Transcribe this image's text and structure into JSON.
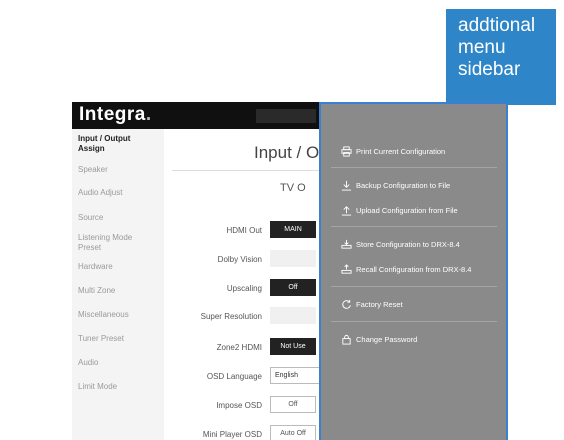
{
  "annotation": {
    "callout_lines": [
      "addtional",
      "menu",
      "sidebar"
    ]
  },
  "app": {
    "logo": "Integra",
    "logo_suffix": "."
  },
  "sidebar": {
    "items": [
      {
        "label": "Input / Output\nAssign",
        "active": true
      },
      {
        "label": "Speaker",
        "active": false
      },
      {
        "label": "Audio Adjust",
        "active": false
      },
      {
        "label": "Source",
        "active": false
      },
      {
        "label": "Listening Mode\nPreset",
        "active": false
      },
      {
        "label": "Hardware",
        "active": false
      },
      {
        "label": "Multi Zone",
        "active": false
      },
      {
        "label": "Miscellaneous",
        "active": false
      },
      {
        "label": "Tuner Preset",
        "active": false
      },
      {
        "label": "Audio",
        "active": false
      },
      {
        "label": "Limit Mode",
        "active": false
      }
    ]
  },
  "main": {
    "title": "Input / O",
    "subtitle": "TV O",
    "rows": [
      {
        "label": "HDMI Out",
        "value": "MAIN",
        "style": "dark"
      },
      {
        "label": "Dolby Vision",
        "value": "",
        "style": "placeholder"
      },
      {
        "label": "Upscaling",
        "value": "Off",
        "style": "dark"
      },
      {
        "label": "Super Resolution",
        "value": "",
        "style": "placeholder"
      },
      {
        "label": "Zone2 HDMI",
        "value": "Not Use",
        "style": "dark"
      },
      {
        "label": "OSD Language",
        "value": "English",
        "style": "select"
      },
      {
        "label": "Impose OSD",
        "value": "Off",
        "style": "light"
      },
      {
        "label": "Mini Player OSD",
        "value": "Auto Off",
        "style": "light"
      }
    ]
  },
  "overlay_menu": {
    "items": [
      {
        "label": "Print Current Configuration",
        "icon": "printer-icon"
      },
      {
        "label": "Backup Configuration to File",
        "icon": "download-icon"
      },
      {
        "label": "Upload Configuration from File",
        "icon": "upload-icon"
      },
      {
        "label": "Store Configuration to DRX-8.4",
        "icon": "store-to-device-icon"
      },
      {
        "label": "Recall Configuration from DRX-8.4",
        "icon": "recall-from-device-icon"
      },
      {
        "label": "Factory Reset",
        "icon": "reset-icon"
      },
      {
        "label": "Change Password",
        "icon": "lock-icon"
      }
    ]
  },
  "colors": {
    "callout": "#2e86c9",
    "overlay_bg": "#8a8a8a",
    "overlay_border": "#3a7fd0",
    "topbar": "#101010"
  }
}
